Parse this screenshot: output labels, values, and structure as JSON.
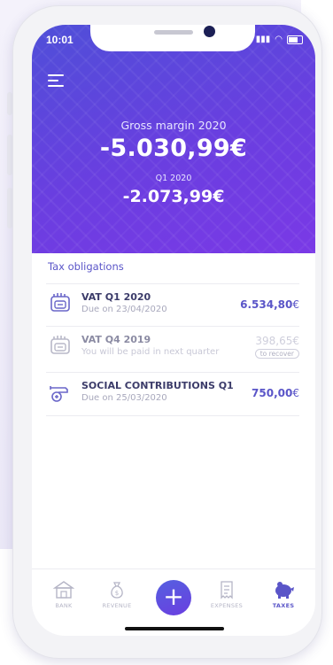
{
  "status": {
    "time": "10:01"
  },
  "header": {
    "gross_margin_label": "Gross margin 2020",
    "gross_margin_value": "-5.030,99€",
    "quarter_label": "Q1 2020",
    "quarter_value": "-2.073,99€"
  },
  "obligations": {
    "title": "Tax obligations",
    "items": [
      {
        "title": "VAT Q1 2020",
        "subtitle": "Due on 23/04/2020",
        "amount": "6.534,80",
        "currency": "€",
        "icon": "vat-icon",
        "status": "due"
      },
      {
        "title": "VAT Q4 2019",
        "subtitle": "You will be paid in next quarter",
        "amount": "398,65",
        "currency": "€",
        "badge": "to recover",
        "icon": "vat-icon",
        "status": "recover"
      },
      {
        "title": "SOCIAL CONTRIBUTIONS Q1",
        "subtitle": "Due on 25/03/2020",
        "amount": "750,00",
        "currency": "€",
        "icon": "social-contributions-icon",
        "status": "due"
      }
    ]
  },
  "nav": {
    "items": [
      {
        "label": "BANK",
        "icon": "bank-icon"
      },
      {
        "label": "REVENUE",
        "icon": "money-bag-icon"
      },
      {
        "label": "",
        "icon": "plus-icon"
      },
      {
        "label": "EXPENSES",
        "icon": "receipt-icon"
      },
      {
        "label": "TAXES",
        "icon": "piggy-icon",
        "active": true
      }
    ]
  },
  "colors": {
    "accent": "#5a55c8",
    "header_start": "#4f4fd8",
    "header_end": "#7a39e6"
  }
}
